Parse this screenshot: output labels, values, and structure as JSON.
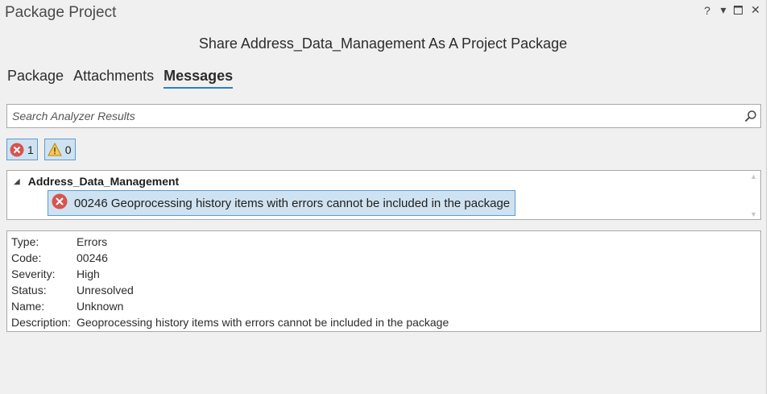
{
  "window": {
    "title": "Package Project",
    "controls": {
      "help": "?",
      "menu": "▾",
      "maximize": "□",
      "close": "✕"
    }
  },
  "header": {
    "subtitle": "Share Address_Data_Management As A Project Package"
  },
  "tabs": [
    {
      "label": "Package",
      "active": false
    },
    {
      "label": "Attachments",
      "active": false
    },
    {
      "label": "Messages",
      "active": true
    }
  ],
  "search": {
    "placeholder": "Search Analyzer Results",
    "value": ""
  },
  "filters": {
    "errors_count": "1",
    "warnings_count": "0"
  },
  "tree": {
    "root_label": "Address_Data_Management",
    "selected_item": "00246 Geoprocessing history items with errors cannot be included in the package"
  },
  "details": {
    "rows": [
      {
        "key": "Type:",
        "value": "Errors"
      },
      {
        "key": "Code:",
        "value": "00246"
      },
      {
        "key": "Severity:",
        "value": "High"
      },
      {
        "key": "Status:",
        "value": "Unresolved"
      },
      {
        "key": "Name:",
        "value": "Unknown"
      },
      {
        "key": "Description:",
        "value": "Geoprocessing history items with errors cannot be included in the package"
      }
    ]
  },
  "colors": {
    "accent": "#2f7fbf",
    "selection_bg": "#cfe2f1",
    "error": "#d9534f",
    "warning": "#f0b429"
  }
}
